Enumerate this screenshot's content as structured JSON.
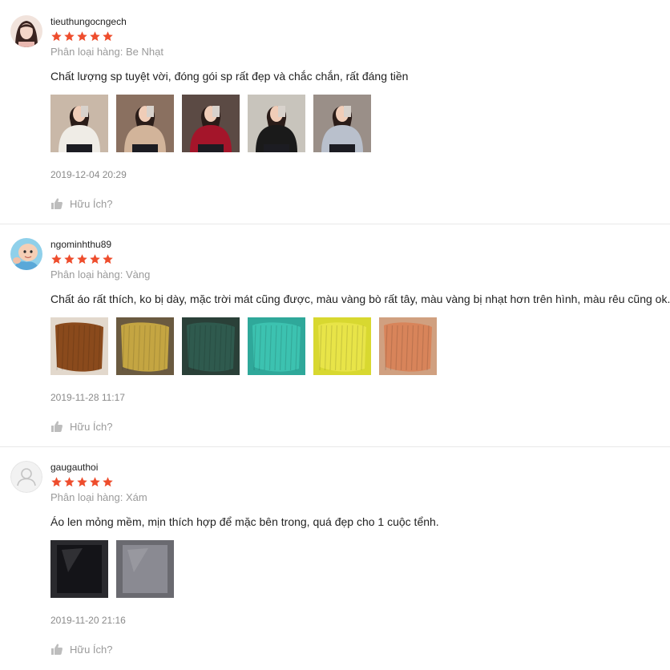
{
  "colors": {
    "star": "#ee4d2d",
    "text_primary": "#222222",
    "text_muted": "#9a9a9a",
    "divider": "#e8e8e8"
  },
  "helpful_label": "Hữu Ích?",
  "helpful_icon": "thumbs-up-icon",
  "reviews": [
    {
      "username": "tieuthungocngech",
      "rating": 5,
      "variant": "Phân loại hàng: Be Nhạt",
      "comment": "Chất lượng sp tuyệt vời, đóng gói sp rất đẹp và chắc chắn, rất đáng tiền",
      "date": "2019-12-04 20:29",
      "avatar": "user-photo-avatar",
      "photos": [
        {
          "name": "photo-beige-sweater",
          "bg": "#c9b8a8",
          "item": "#efece6"
        },
        {
          "name": "photo-tan-sweater",
          "bg": "#8a7060",
          "item": "#d2b49a"
        },
        {
          "name": "photo-red-sweater",
          "bg": "#5b4a44",
          "item": "#a4152a"
        },
        {
          "name": "photo-black-sweater",
          "bg": "#c8c4bc",
          "item": "#1a1a1a"
        },
        {
          "name": "photo-grey-sweater",
          "bg": "#9a8f88",
          "item": "#b9c0cc"
        }
      ]
    },
    {
      "username": "ngominhthu89",
      "rating": 5,
      "variant": "Phân loại hàng: Vàng",
      "comment": "Chất áo rất thích, ko bị dày, mặc trời mát cũng được, màu vàng bò rất tây, màu vàng bị nhạt hơn trên hình, màu rêu cũng ok.",
      "date": "2019-11-28 11:17",
      "avatar": "baby-photo-avatar",
      "photos": [
        {
          "name": "photo-brown-knit",
          "bg": "#e2d8cc",
          "item": "#8a4a1c"
        },
        {
          "name": "photo-mustard-knit",
          "bg": "#6a5a40",
          "item": "#c4a542"
        },
        {
          "name": "photo-green-knit",
          "bg": "#2a4038",
          "item": "#2f5a4e"
        },
        {
          "name": "photo-teal-knit",
          "bg": "#2fa89a",
          "item": "#3cc2b0"
        },
        {
          "name": "photo-yellow-knit",
          "bg": "#d8d830",
          "item": "#e8e448"
        },
        {
          "name": "photo-orange-knit",
          "bg": "#d0a080",
          "item": "#d8845a"
        }
      ]
    },
    {
      "username": "gaugauthoi",
      "rating": 5,
      "variant": "Phân loại hàng: Xám",
      "comment": "Áo len mỏng mềm, mịn thích hợp để mặc bên trong, quá đẹp cho 1 cuộc tểnh.",
      "date": "2019-11-20 21:16",
      "avatar": "default-user-avatar",
      "photos": [
        {
          "name": "photo-black-packaged",
          "bg": "#2a2a2e",
          "item": "#141418"
        },
        {
          "name": "photo-grey-packaged",
          "bg": "#6a6a70",
          "item": "#8a8a92"
        }
      ]
    }
  ]
}
